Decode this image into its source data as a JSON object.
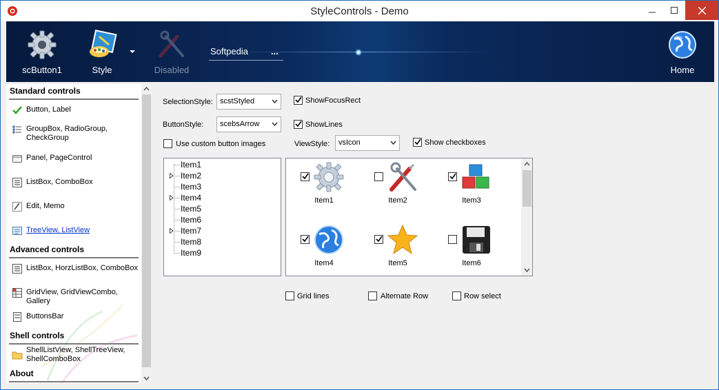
{
  "window": {
    "title": "StyleControls - Demo"
  },
  "toolbar": {
    "buttons": [
      {
        "label": "scButton1",
        "icon": "gear-icon"
      },
      {
        "label": "Style",
        "icon": "paint-icon"
      },
      {
        "label": "Disabled",
        "icon": "tools-icon"
      },
      {
        "label": "Home",
        "icon": "globe-icon"
      }
    ],
    "text": "Softpedia",
    "dots": "..."
  },
  "sidebar": {
    "categories": [
      {
        "title": "Standard controls"
      },
      {
        "title": "Advanced controls"
      },
      {
        "title": "Shell controls"
      },
      {
        "title": "About"
      }
    ],
    "items": [
      {
        "label": "Button, Label",
        "icon": "check-icon"
      },
      {
        "label": "GroupBox, RadioGroup, CheckGroup",
        "icon": "radio-list-icon"
      },
      {
        "label": "Panel, PageControl",
        "icon": "panel-icon"
      },
      {
        "label": "ListBox, ComboBox",
        "icon": "listbox-icon"
      },
      {
        "label": "Edit, Memo",
        "icon": "edit-icon"
      },
      {
        "label": "TreeView, ListView",
        "icon": "treeview-icon"
      },
      {
        "label": "ListBox, HorzListBox, ComboBox",
        "icon": "listbox-icon"
      },
      {
        "label": "GridView, GridViewCombo, Gallery",
        "icon": "grid-icon"
      },
      {
        "label": "ButtonsBar",
        "icon": "buttonsbar-icon"
      },
      {
        "label": "ShellListView, ShellTreeView, ShellComboBox",
        "icon": "folder-icon"
      }
    ],
    "selected_item": "TreeView, ListView"
  },
  "controls": {
    "selection_style_label": "SelectionStyle:",
    "selection_style_value": "scstStyled",
    "button_style_label": "ButtonStyle:",
    "button_style_value": "scebsArrow",
    "view_style_label": "ViewStyle:",
    "view_style_value": "vsIcon",
    "show_focus_rect": {
      "label": "ShowFocusRect",
      "checked": true
    },
    "show_lines": {
      "label": "ShowLines",
      "checked": true
    },
    "custom_button_images": {
      "label": "Use custom button images",
      "checked": false
    },
    "show_checkboxes": {
      "label": "Show checkboxes",
      "checked": true
    },
    "grid_lines": {
      "label": "Grid lines",
      "checked": false
    },
    "alternate_row": {
      "label": "Alternate Row",
      "checked": false
    },
    "row_select": {
      "label": "Row select",
      "checked": false
    }
  },
  "tree": {
    "items": [
      {
        "label": "Item1",
        "expandable": false
      },
      {
        "label": "Item2",
        "expandable": true
      },
      {
        "label": "Item3",
        "expandable": false
      },
      {
        "label": "Item4",
        "expandable": true
      },
      {
        "label": "Item5",
        "expandable": false
      },
      {
        "label": "Item6",
        "expandable": false
      },
      {
        "label": "Item7",
        "expandable": true
      },
      {
        "label": "Item8",
        "expandable": false
      },
      {
        "label": "Item9",
        "expandable": false
      }
    ]
  },
  "listview": {
    "items": [
      {
        "label": "Item1",
        "checked": true,
        "icon": "gear-icon"
      },
      {
        "label": "Item2",
        "checked": false,
        "icon": "tools-icon"
      },
      {
        "label": "Item3",
        "checked": true,
        "icon": "cubes-icon"
      },
      {
        "label": "Item4",
        "checked": true,
        "icon": "globe-icon"
      },
      {
        "label": "Item5",
        "checked": true,
        "icon": "star-icon"
      },
      {
        "label": "Item6",
        "checked": false,
        "icon": "floppy-icon"
      }
    ]
  }
}
